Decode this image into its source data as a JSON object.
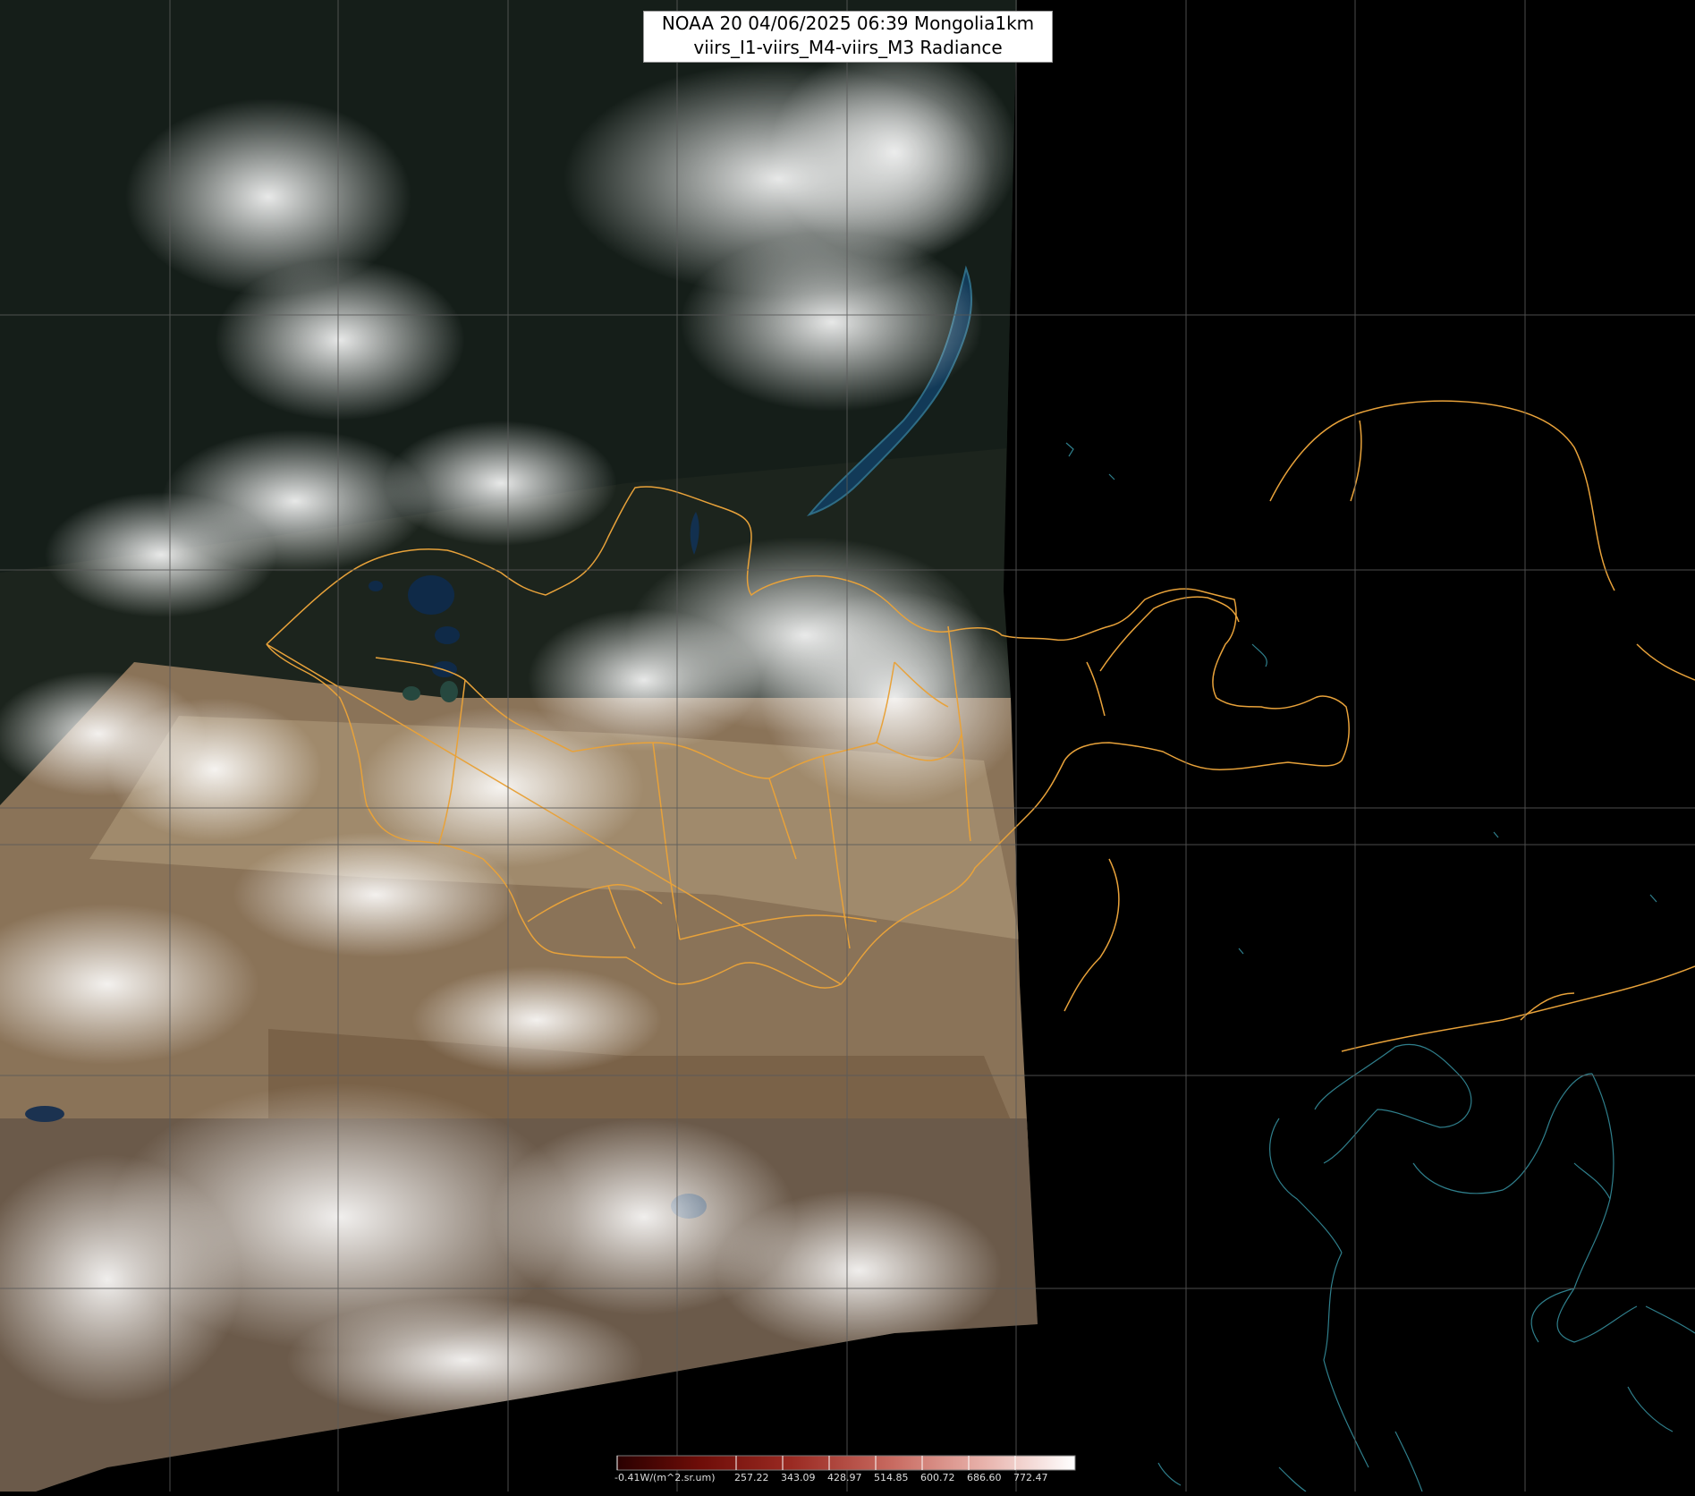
{
  "title": {
    "line1": "NOAA 20 04/06/2025 06:39 Mongolia1km",
    "line2": "viirs_I1-viirs_M4-viirs_M3 Radiance"
  },
  "legend": {
    "unit_label": "-0.41W/(m^2.sr.um)",
    "ticks": [
      "257.22",
      "343.09",
      "428.97",
      "514.85",
      "600.72",
      "686.60",
      "772.47"
    ],
    "colors": [
      "#3a0000",
      "#6e0d08",
      "#9a2a22",
      "#c05a50",
      "#dc8f86",
      "#efc5bf",
      "#ffffff"
    ]
  },
  "map": {
    "border_color": "#e8a23a",
    "coast_color": "#2f7f8c",
    "grid_color": "#5a5a5a",
    "background": "#000000"
  }
}
